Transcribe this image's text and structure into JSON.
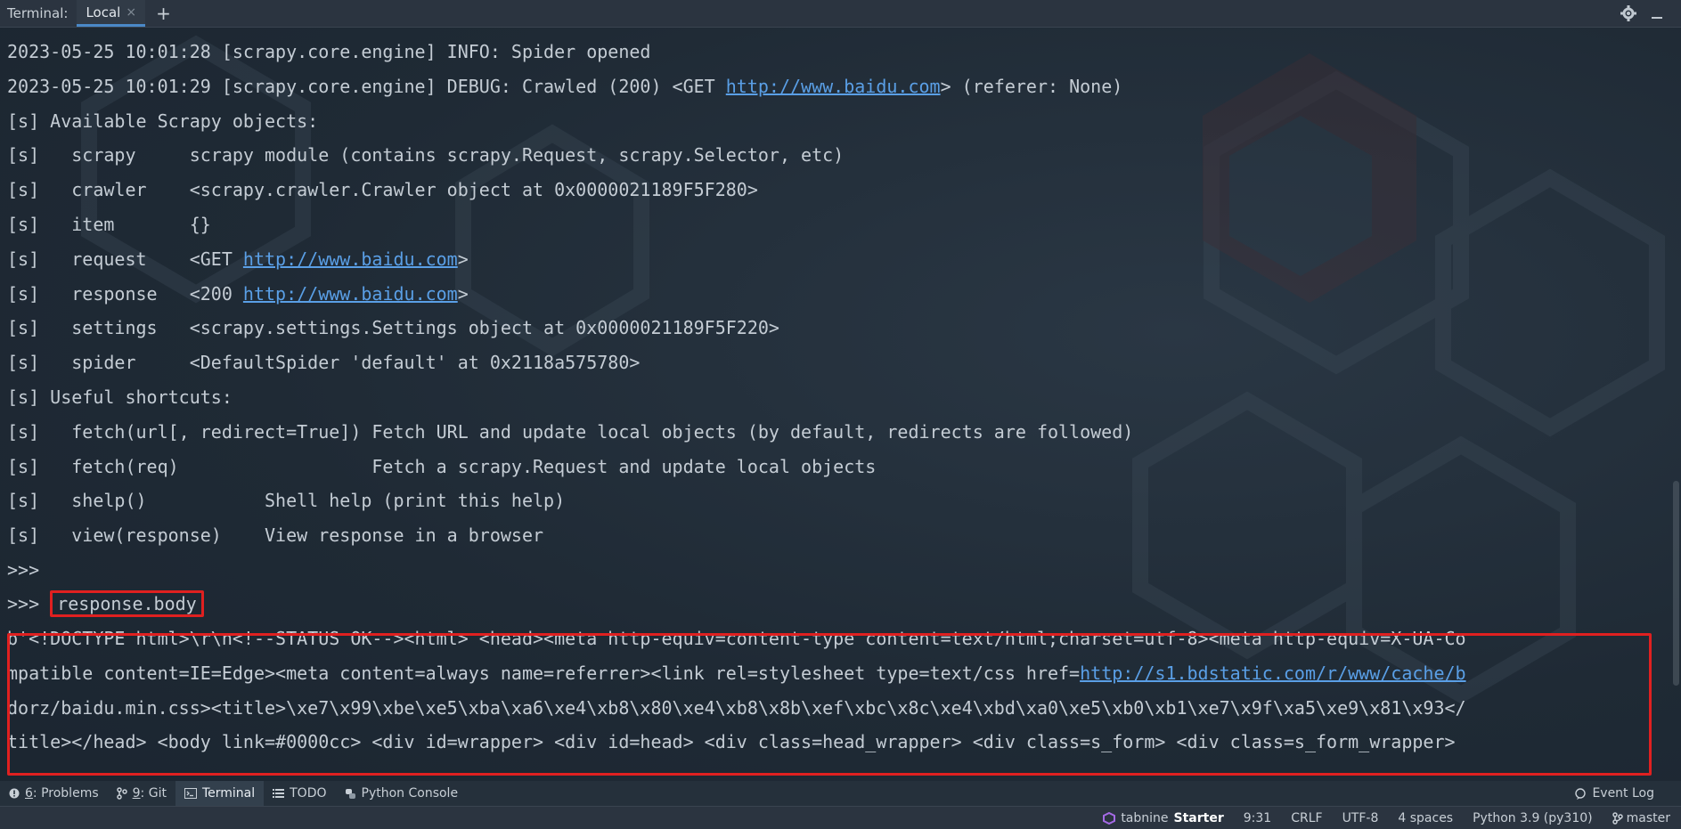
{
  "tabbar": {
    "label": "Terminal:",
    "tab_label": "Local",
    "close_glyph": "×",
    "new_tab_glyph": "+",
    "settings_icon": "gear-icon",
    "minimize_icon": "minimize-icon"
  },
  "terminal": {
    "lines": [
      {
        "parts": [
          {
            "t": "2023-05-25 10:01:28 [scrapy.core.engine] INFO: Spider opened"
          }
        ]
      },
      {
        "parts": [
          {
            "t": "2023-05-25 10:01:29 [scrapy.core.engine] DEBUG: Crawled (200) <GET "
          },
          {
            "t": "http://www.baidu.com",
            "link": true
          },
          {
            "t": "> (referer: None)"
          }
        ]
      },
      {
        "parts": [
          {
            "t": "[s] Available Scrapy objects:"
          }
        ]
      },
      {
        "parts": [
          {
            "t": "[s]   scrapy     scrapy module (contains scrapy.Request, scrapy.Selector, etc)"
          }
        ]
      },
      {
        "parts": [
          {
            "t": "[s]   crawler    <scrapy.crawler.Crawler object at 0x0000021189F5F280>"
          }
        ]
      },
      {
        "parts": [
          {
            "t": "[s]   item       {}"
          }
        ]
      },
      {
        "parts": [
          {
            "t": "[s]   request    <GET "
          },
          {
            "t": "http://www.baidu.com",
            "link": true
          },
          {
            "t": ">"
          }
        ]
      },
      {
        "parts": [
          {
            "t": "[s]   response   <200 "
          },
          {
            "t": "http://www.baidu.com",
            "link": true
          },
          {
            "t": ">"
          }
        ]
      },
      {
        "parts": [
          {
            "t": "[s]   settings   <scrapy.settings.Settings object at 0x0000021189F5F220>"
          }
        ]
      },
      {
        "parts": [
          {
            "t": "[s]   spider     <DefaultSpider 'default' at 0x2118a575780>"
          }
        ]
      },
      {
        "parts": [
          {
            "t": "[s] Useful shortcuts:"
          }
        ]
      },
      {
        "parts": [
          {
            "t": "[s]   fetch(url[, redirect=True]) Fetch URL and update local objects (by default, redirects are followed)"
          }
        ]
      },
      {
        "parts": [
          {
            "t": "[s]   fetch(req)                  Fetch a scrapy.Request and update local objects"
          }
        ]
      },
      {
        "parts": [
          {
            "t": "[s]   shelp()           Shell help (print this help)"
          }
        ]
      },
      {
        "parts": [
          {
            "t": "[s]   view(response)    View response in a browser"
          }
        ]
      },
      {
        "parts": [
          {
            "t": ">>>"
          }
        ]
      }
    ],
    "prompt": ">>> ",
    "command": "response.body",
    "body_lines": [
      {
        "parts": [
          {
            "t": "b'<!DOCTYPE html>\\r\\n<!--STATUS OK--><html> <head><meta http-equiv=content-type content=text/html;charset=utf-8><meta http-equiv=X-UA-Co"
          }
        ]
      },
      {
        "parts": [
          {
            "t": "mpatible content=IE=Edge><meta content=always name=referrer><link rel=stylesheet type=text/css href="
          },
          {
            "t": "http://s1.bdstatic.com/r/www/cache/b",
            "link": true
          }
        ]
      },
      {
        "parts": [
          {
            "t": "dorz/baidu.min.css><title>\\xe7\\x99\\xbe\\xe5\\xba\\xa6\\xe4\\xb8\\x80\\xe4\\xb8\\x8b\\xef\\xbc\\x8c\\xe4\\xbd\\xa0\\xe5\\xb0\\xb1\\xe7\\x9f\\xa5\\xe9\\x81\\x93</"
          }
        ]
      },
      {
        "parts": [
          {
            "t": "title></head> <body link=#0000cc> <div id=wrapper> <div id=head> <div class=head_wrapper> <div class=s_form> <div class=s_form_wrapper>"
          }
        ]
      }
    ]
  },
  "toolwindows": [
    {
      "name": "problems",
      "icon": "problems-icon",
      "num": "6",
      "label": ": Problems",
      "active": false
    },
    {
      "name": "git",
      "icon": "git-branch-icon",
      "num": "9",
      "label": ": Git",
      "active": false
    },
    {
      "name": "terminal",
      "icon": "terminal-icon",
      "num": "",
      "label": "Terminal",
      "active": true
    },
    {
      "name": "todo",
      "icon": "list-icon",
      "num": "",
      "label": "TODO",
      "active": false
    },
    {
      "name": "python-console",
      "icon": "python-icon",
      "num": "",
      "label": "Python Console",
      "active": false
    }
  ],
  "event_log": "Event Log",
  "statusbar": {
    "tabnine_prefix": "tabnine",
    "tabnine_plan": "Starter",
    "position": "9:31",
    "line_sep": "CRLF",
    "encoding": "UTF-8",
    "indent": "4 spaces",
    "interpreter": "Python 3.9 (py310)",
    "branch": "master"
  },
  "colors": {
    "link": "#5a9fe6",
    "highlight_box": "#e02020",
    "active_tab_underline": "#4a88c7"
  }
}
